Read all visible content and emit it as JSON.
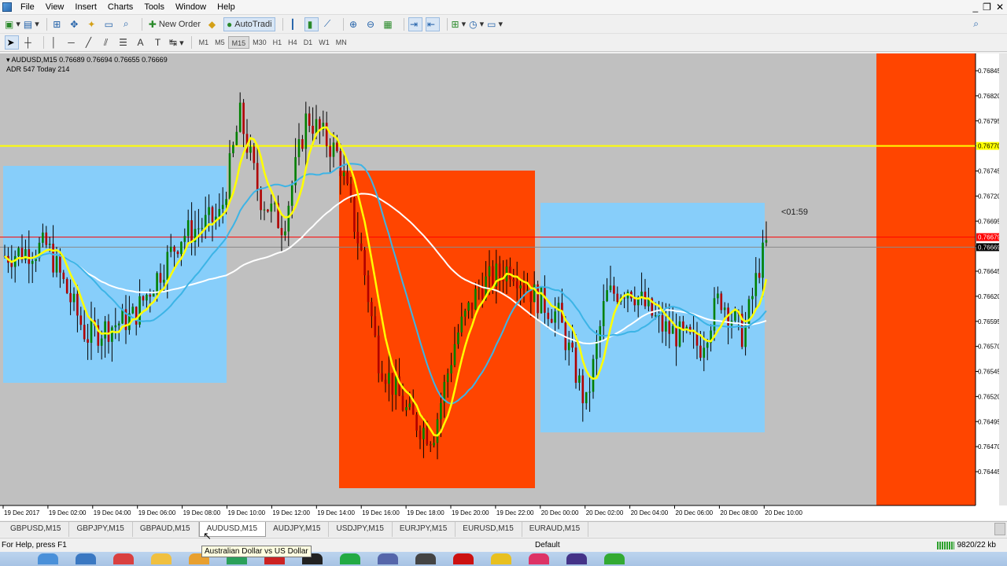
{
  "menubar": {
    "items": [
      "File",
      "View",
      "Insert",
      "Charts",
      "Tools",
      "Window",
      "Help"
    ]
  },
  "toolbar1": {
    "new_order": "New Order",
    "auto_trading": "AutoTradi"
  },
  "toolbar2": {
    "timeframes": [
      "M1",
      "M5",
      "M15",
      "M30",
      "H1",
      "H4",
      "D1",
      "W1",
      "MN"
    ],
    "active_timeframe": "M15"
  },
  "chart": {
    "title": "AUDUSD,M15",
    "ohlc": "0.76689 0.76694 0.76655 0.76669",
    "adr": "ADR 547  Today 214",
    "timer": "<01:59",
    "price_labels": [
      "0.76845",
      "0.76820",
      "0.76795",
      "0.76770",
      "0.76745",
      "0.76720",
      "0.76695",
      "0.76670",
      "0.76645",
      "0.76620",
      "0.76595",
      "0.76570",
      "0.76545",
      "0.76520",
      "0.76495",
      "0.76470",
      "0.76445"
    ],
    "current_bid": "0.76669",
    "red_line_price": "0.76679",
    "yellow_line_price": "0.76770",
    "time_labels": [
      "19 Dec 2017",
      "19 Dec 02:00",
      "19 Dec 04:00",
      "19 Dec 06:00",
      "19 Dec 08:00",
      "19 Dec 10:00",
      "19 Dec 12:00",
      "19 Dec 14:00",
      "19 Dec 16:00",
      "19 Dec 18:00",
      "19 Dec 20:00",
      "19 Dec 22:00",
      "20 Dec 00:00",
      "20 Dec 02:00",
      "20 Dec 04:00",
      "20 Dec 06:00",
      "20 Dec 08:00",
      "20 Dec 10:00"
    ],
    "colors": {
      "background": "#c0c0c0",
      "session_blue": "#87cefa",
      "session_orange": "#ff4500",
      "bull": "#008000",
      "bear": "#b00000",
      "ma_yellow": "#ffff00",
      "ma_blue": "#3cb4e6",
      "ma_white": "#ffffff",
      "level_yellow": "#ffff00",
      "level_red": "#ff0000"
    }
  },
  "tabs": {
    "items": [
      "GBPUSD,M15",
      "GBPJPY,M15",
      "GBPAUD,M15",
      "AUDUSD,M15",
      "AUDJPY,M15",
      "USDJPY,M15",
      "EURJPY,M15",
      "EURUSD,M15",
      "EURAUD,M15"
    ],
    "active": "AUDUSD,M15"
  },
  "tooltip": "Australian Dollar vs US Dollar",
  "statusbar": {
    "help": "For Help, press F1",
    "profile": "Default",
    "traffic": "9820/22 kb"
  }
}
